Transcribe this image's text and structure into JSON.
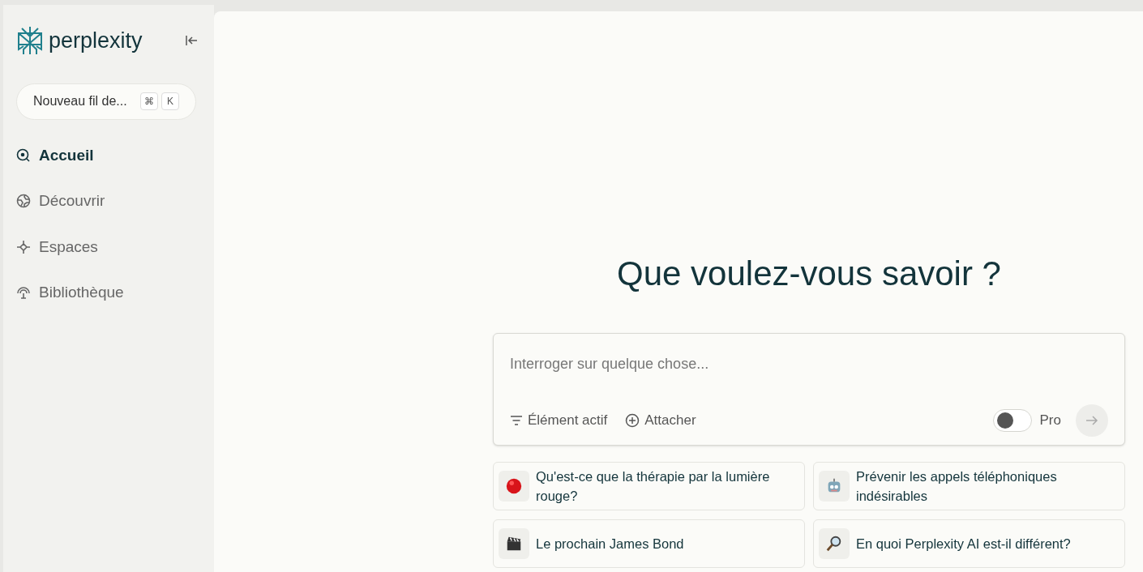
{
  "sidebar": {
    "logo": "perplexity",
    "new_thread": {
      "label": "Nouveau fil de...",
      "keys": [
        "⌘",
        "K"
      ]
    },
    "items": [
      {
        "label": "Accueil",
        "kind": "search",
        "selected": true
      },
      {
        "label": "Découvrir",
        "kind": "globe",
        "selected": false
      },
      {
        "label": "Espaces",
        "kind": "sparkle",
        "selected": false
      },
      {
        "label": "Bibliothèque",
        "kind": "library",
        "selected": false
      }
    ]
  },
  "main": {
    "heading": "Que voulez-vous savoir ?",
    "search": {
      "placeholder": "Interroger sur quelque chose...",
      "focus": "Élément actif",
      "attach": "Attacher",
      "pro": {
        "label": "Pro",
        "on": false
      }
    },
    "suggestions": [
      {
        "kind": "ball",
        "text": "Qu'est-ce que la thérapie par la lumière rouge?"
      },
      {
        "kind": "robot",
        "text": "Prévenir les appels téléphoniques indésirables"
      },
      {
        "kind": "clapper",
        "text": "Le prochain James Bond"
      },
      {
        "kind": "magnifier",
        "text": "En quoi Perplexity AI est-il différent?"
      }
    ]
  }
}
